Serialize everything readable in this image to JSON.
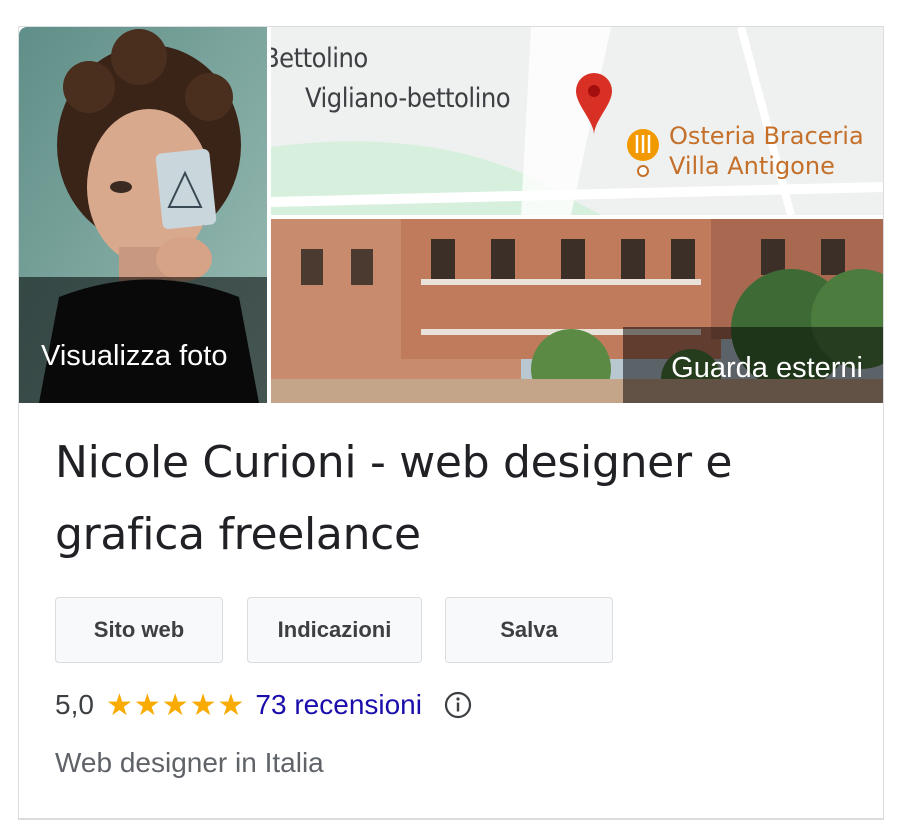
{
  "media": {
    "photo_label": "Visualizza foto",
    "map": {
      "label_partial": "Bettolino",
      "label_town": "Vigliano-bettolino",
      "poi_line1": "Osteria Braceria",
      "poi_line2": "Villa Antigone"
    },
    "street_label": "Guarda esterni"
  },
  "business": {
    "title": "Nicole Curioni - web designer e grafica freelance",
    "category": "Web designer in Italia"
  },
  "actions": {
    "website": "Sito web",
    "directions": "Indicazioni",
    "save": "Salva"
  },
  "rating": {
    "score": "5,0",
    "stars_text": "★★★★★",
    "stars_value": 5,
    "reviews": "73 recensioni"
  },
  "colors": {
    "star": "#f9ab00",
    "link": "#1a0dab",
    "map_pin": "#d93025",
    "poi": "#f29900"
  }
}
